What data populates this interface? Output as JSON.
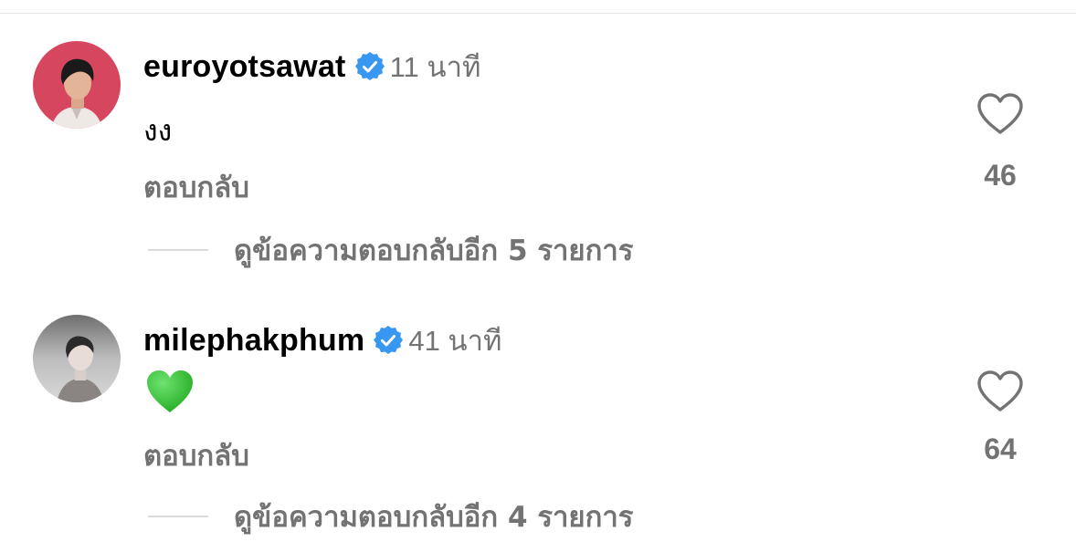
{
  "comments": [
    {
      "username": "euroyotsawat",
      "verified": true,
      "time": "11 นาที",
      "text": "งง",
      "reply_label": "ตอบกลับ",
      "likes": "46",
      "view_replies_label": "ดูข้อความตอบกลับอีก 5 รายการ",
      "avatar_bg": "#d6475f"
    },
    {
      "username": "milephakphum",
      "verified": true,
      "time": "41 นาที",
      "emoji": "green-heart",
      "reply_label": "ตอบกลับ",
      "likes": "64",
      "view_replies_label": "ดูข้อความตอบกลับอีก 4 รายการ",
      "avatar_bg": "#9a9a9a"
    }
  ],
  "colors": {
    "verified_badge": "#3897f0",
    "secondary_text": "#737373",
    "emoji_heart": "#3cc83c"
  }
}
